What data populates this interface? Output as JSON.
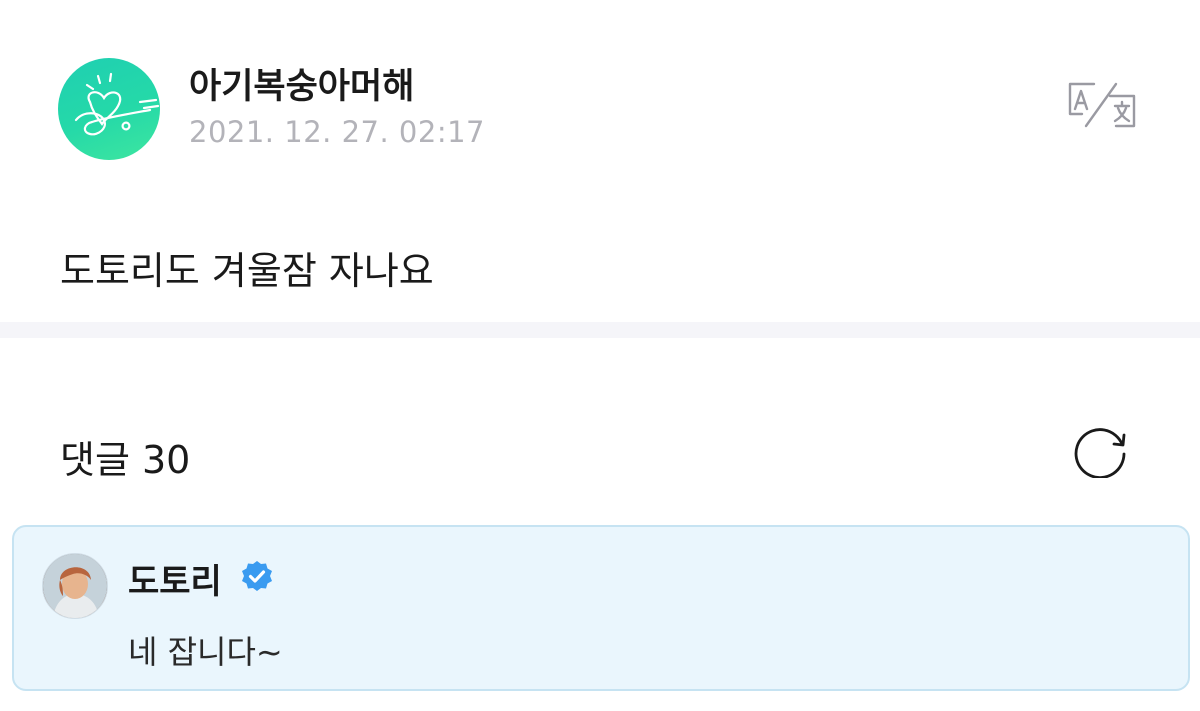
{
  "post": {
    "author_name": "아기복숭아머해",
    "date": "2021. 12. 27. 02:17",
    "body": "도토리도 겨울잠 자나요",
    "avatar_icon": "artist-logo-heart-icon",
    "translate_icon": "translate-icon"
  },
  "comments": {
    "title": "댓글 30",
    "refresh_icon": "refresh-icon",
    "items": [
      {
        "author_name": "도토리",
        "verified": true,
        "text": "네 잡니다~"
      }
    ]
  },
  "colors": {
    "avatar_gradient_start": "#1fcfb2",
    "avatar_gradient_end": "#3ee6a0",
    "date_gray": "#b3b3b9",
    "divider": "#f5f5f9",
    "comment_bg": "#eaf6fd",
    "comment_border": "#c6e3f2",
    "verified_blue": "#3a9bf0"
  }
}
